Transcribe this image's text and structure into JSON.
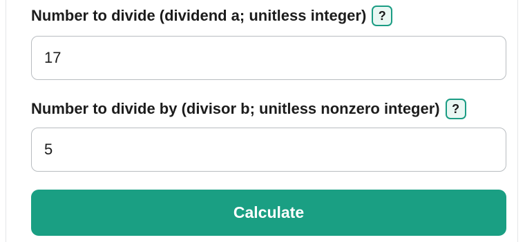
{
  "form": {
    "dividend": {
      "label": "Number to divide (dividend a; unitless integer)",
      "help_label": "?",
      "value": "17",
      "help_icon": "question-mark-icon"
    },
    "divisor": {
      "label": "Number to divide by (divisor b; unitless nonzero integer)",
      "help_label": "?",
      "value": "5",
      "help_icon": "question-mark-icon"
    },
    "calculate_label": "Calculate"
  },
  "colors": {
    "accent": "#1a9f83",
    "help_border": "#1a9c83",
    "help_bg": "#e9f7f3",
    "text": "#1c1c1c",
    "input_border": "#b8bcc0"
  }
}
